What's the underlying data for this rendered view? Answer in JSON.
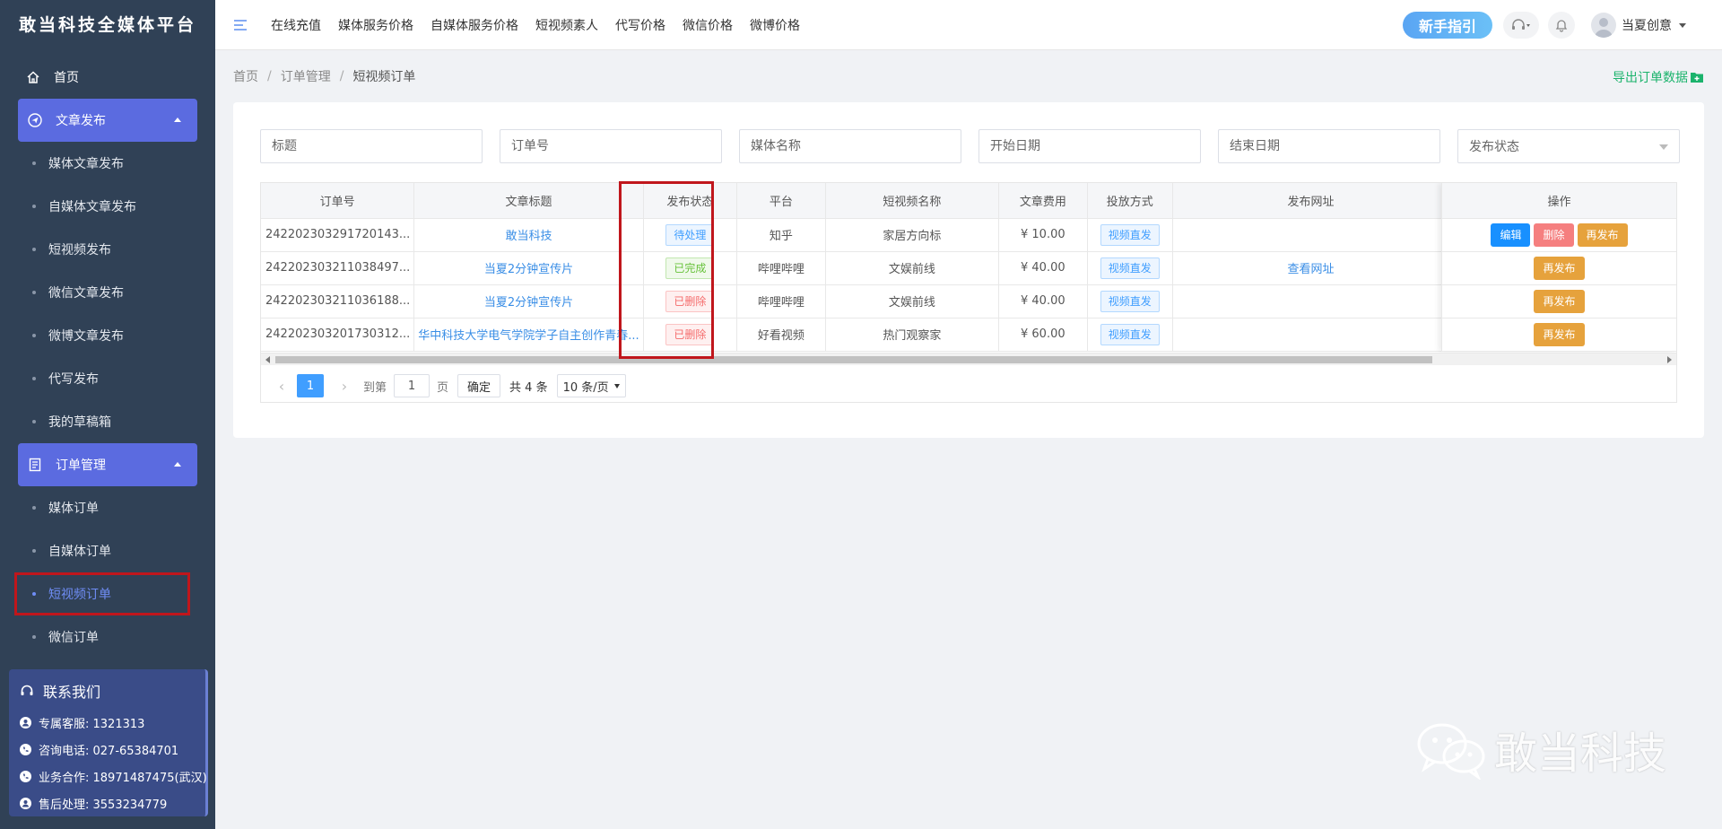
{
  "app": {
    "logo_text": "敢当科技全媒体平台"
  },
  "sidebar": {
    "home": "首页",
    "groups": [
      {
        "label": "文章发布",
        "items": [
          "媒体文章发布",
          "自媒体文章发布",
          "短视频发布",
          "微信文章发布",
          "微博文章发布",
          "代写发布",
          "我的草稿箱"
        ]
      },
      {
        "label": "订单管理",
        "items": [
          "媒体订单",
          "自媒体订单",
          "短视频订单",
          "微信订单"
        ]
      }
    ],
    "active_item": "短视频订单"
  },
  "contact": {
    "title": "联系我们",
    "rows": [
      "专属客服: 1321313",
      "咨询电话: 027-65384701",
      "业务合作: 18971487475(武汉)",
      "售后处理: 3553234779"
    ]
  },
  "header": {
    "nav": [
      "在线充值",
      "媒体服务价格",
      "自媒体服务价格",
      "短视频素人",
      "代写价格",
      "微信价格",
      "微博价格"
    ],
    "guide_button": "新手指引",
    "username": "当夏创意"
  },
  "breadcrumb": [
    "首页",
    "订单管理",
    "短视频订单"
  ],
  "export_label": "导出订单数据",
  "filters": {
    "title_placeholder": "标题",
    "order_no_placeholder": "订单号",
    "media_name_placeholder": "媒体名称",
    "start_date_placeholder": "开始日期",
    "end_date_placeholder": "结束日期",
    "status_placeholder": "发布状态"
  },
  "table": {
    "headers": [
      "订单号",
      "文章标题",
      "发布状态",
      "平台",
      "短视频名称",
      "文章费用",
      "投放方式",
      "发布网址",
      "操作"
    ],
    "rows": [
      {
        "order_no": "242202303291720143...",
        "title": "敢当科技",
        "status": "待处理",
        "status_type": "pending",
        "platform": "知乎",
        "video_name": "家居方向标",
        "fee": "¥ 10.00",
        "method": "视频直发",
        "url": "",
        "ops": [
          "编辑",
          "删除",
          "再发布"
        ]
      },
      {
        "order_no": "242202303211038497...",
        "title": "当夏2分钟宣传片",
        "status": "已完成",
        "status_type": "done",
        "platform": "哔哩哔哩",
        "video_name": "文娱前线",
        "fee": "¥ 40.00",
        "method": "视频直发",
        "url": "查看网址",
        "ops": [
          "再发布"
        ]
      },
      {
        "order_no": "242202303211036188...",
        "title": "当夏2分钟宣传片",
        "status": "已删除",
        "status_type": "deleted",
        "platform": "哔哩哔哩",
        "video_name": "文娱前线",
        "fee": "¥ 40.00",
        "method": "视频直发",
        "url": "",
        "ops": [
          "再发布"
        ]
      },
      {
        "order_no": "242202303201730312...",
        "title": "华中科技大学电气学院学子自主创作青春...",
        "status": "已删除",
        "status_type": "deleted",
        "platform": "好看视频",
        "video_name": "热门观察家",
        "fee": "¥ 60.00",
        "method": "视频直发",
        "url": "",
        "ops": [
          "再发布"
        ]
      }
    ]
  },
  "pagination": {
    "current_page": "1",
    "goto_label": "到第",
    "goto_value": "1",
    "page_suffix": "页",
    "confirm_label": "确定",
    "total": "共 4 条",
    "page_size": "10 条/页"
  },
  "watermark": "敢当科技",
  "colors": {
    "sidebar_bg": "#304156",
    "sidebar_active_group": "#5b6be0",
    "primary": "#409eff",
    "export_green": "#1bb36c",
    "highlight_red": "#c0161c"
  }
}
